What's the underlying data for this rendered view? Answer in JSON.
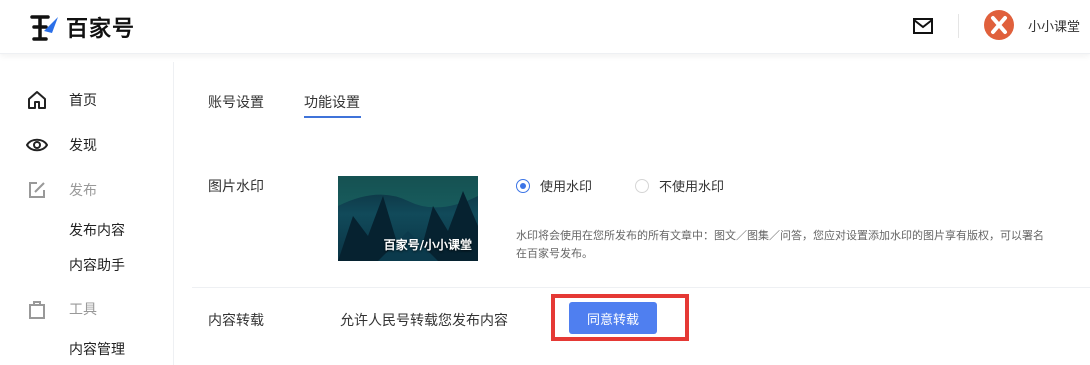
{
  "header": {
    "logo_text": "百家号",
    "mail_icon": "mail-icon",
    "username": "小小课堂"
  },
  "sidebar": {
    "items": [
      {
        "label": "首页",
        "icon": "home-icon"
      },
      {
        "label": "发现",
        "icon": "eye-icon"
      },
      {
        "label": "发布",
        "icon": "edit-icon",
        "sub": [
          "发布内容",
          "内容助手"
        ]
      },
      {
        "label": "工具",
        "icon": "bag-icon",
        "sub": [
          "内容管理"
        ]
      }
    ]
  },
  "tabs": [
    {
      "label": "账号设置",
      "active": false
    },
    {
      "label": "功能设置",
      "active": true
    }
  ],
  "watermark": {
    "label": "图片水印",
    "preview_text": "百家号/小小课堂",
    "options": [
      {
        "label": "使用水印",
        "checked": true
      },
      {
        "label": "不使用水印",
        "checked": false
      }
    ],
    "description_line1": "水印将会使用在您所发布的所有文章中：图文／图集／问答，您应对设置添加水印的图片享有版权，可以署名",
    "description_line2": "在百家号发布。"
  },
  "forward": {
    "label": "内容转载",
    "text": "允许人民号转载您发布内容",
    "button": "同意转载"
  },
  "colors": {
    "accent": "#3f73d9",
    "button": "#4f7ff0",
    "highlight": "#e53935",
    "avatar": "#e0603c"
  }
}
